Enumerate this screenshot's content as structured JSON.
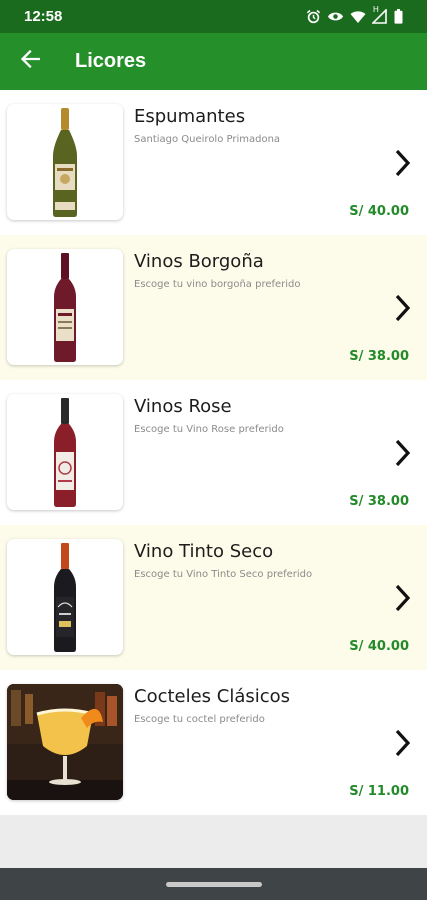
{
  "status_bar": {
    "time": "12:58",
    "icons": [
      "alarm-icon",
      "eye-icon",
      "wifi-icon",
      "signal-icon",
      "battery-icon"
    ],
    "network_label": "H"
  },
  "app_bar": {
    "title": "Licores",
    "back_icon": "arrow-left-icon",
    "color": "#258f2a"
  },
  "items": [
    {
      "title": "Espumantes",
      "subtitle": "Santiago Queirolo Primadona",
      "price": "S/ 40.00",
      "image": "sparkling-wine-bottle"
    },
    {
      "title": "Vinos Borgoña",
      "subtitle": "Escoge tu vino borgoña preferido",
      "price": "S/ 38.00",
      "image": "burgundy-wine-bottle"
    },
    {
      "title": "Vinos Rose",
      "subtitle": "Escoge tu Vino Rose preferido",
      "price": "S/ 38.00",
      "image": "rose-wine-bottle"
    },
    {
      "title": "Vino Tinto Seco",
      "subtitle": "Escoge tu Vino Tinto Seco preferido",
      "price": "S/ 40.00",
      "image": "red-wine-bottle"
    },
    {
      "title": "Cocteles Clásicos",
      "subtitle": "Escoge tu coctel preferido",
      "price": "S/ 11.00",
      "image": "cocktail-glass"
    }
  ],
  "colors": {
    "status_bar": "#1b6b1f",
    "price": "#238a2a",
    "alt_row": "#fdfbe9"
  }
}
